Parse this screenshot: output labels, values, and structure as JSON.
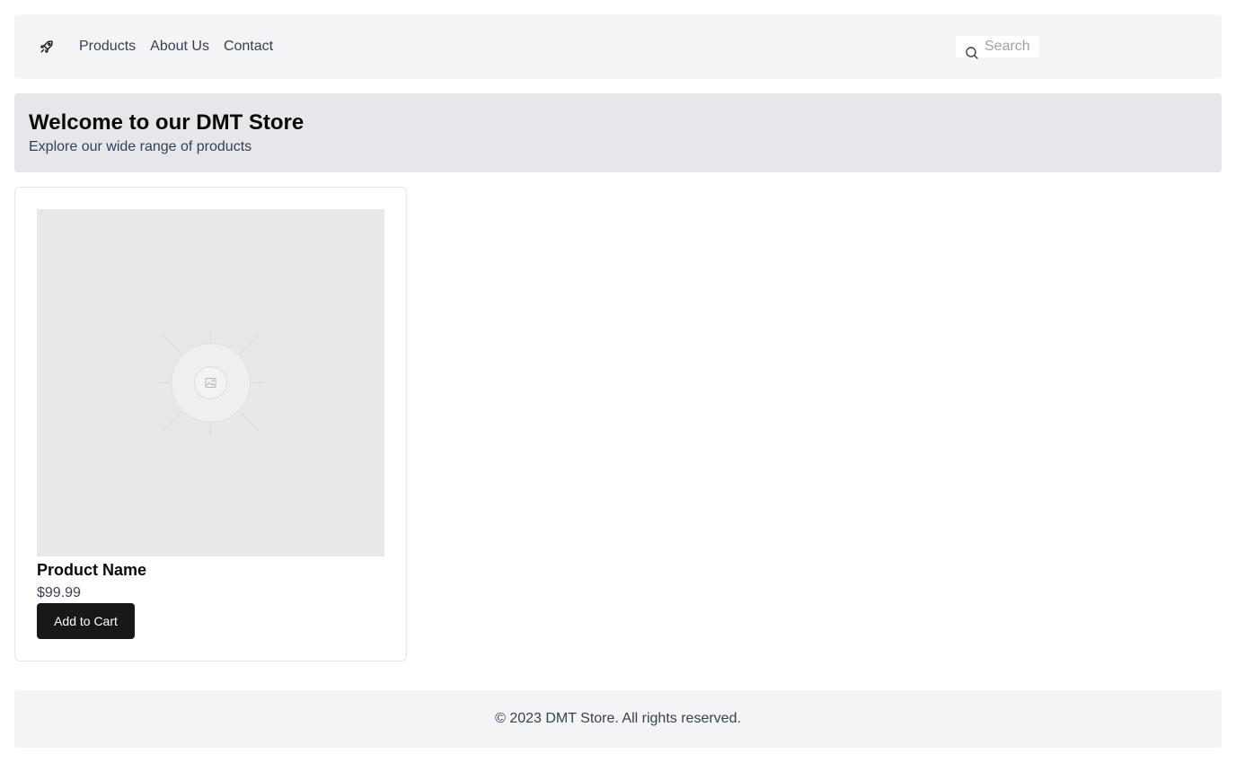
{
  "navbar": {
    "logo_icon": "rocket-icon",
    "links": [
      {
        "label": "Products"
      },
      {
        "label": "About Us"
      },
      {
        "label": "Contact"
      }
    ],
    "search": {
      "icon": "search-icon",
      "placeholder": "Search",
      "value": ""
    }
  },
  "hero": {
    "title": "Welcome to our DMT Store",
    "subtitle": "Explore our wide range of products"
  },
  "products": [
    {
      "image_icon": "image-placeholder-icon",
      "name": "Product Name",
      "price": "$99.99",
      "button_label": "Add to Cart"
    }
  ],
  "footer": {
    "text": "© 2023 DMT Store. All rights reserved."
  },
  "colors": {
    "navbar_bg": "#f3f4f6",
    "hero_bg": "#e5e7eb",
    "button_bg": "#18181b",
    "button_text": "#ffffff",
    "image_placeholder_bg": "#e8e8e8"
  }
}
